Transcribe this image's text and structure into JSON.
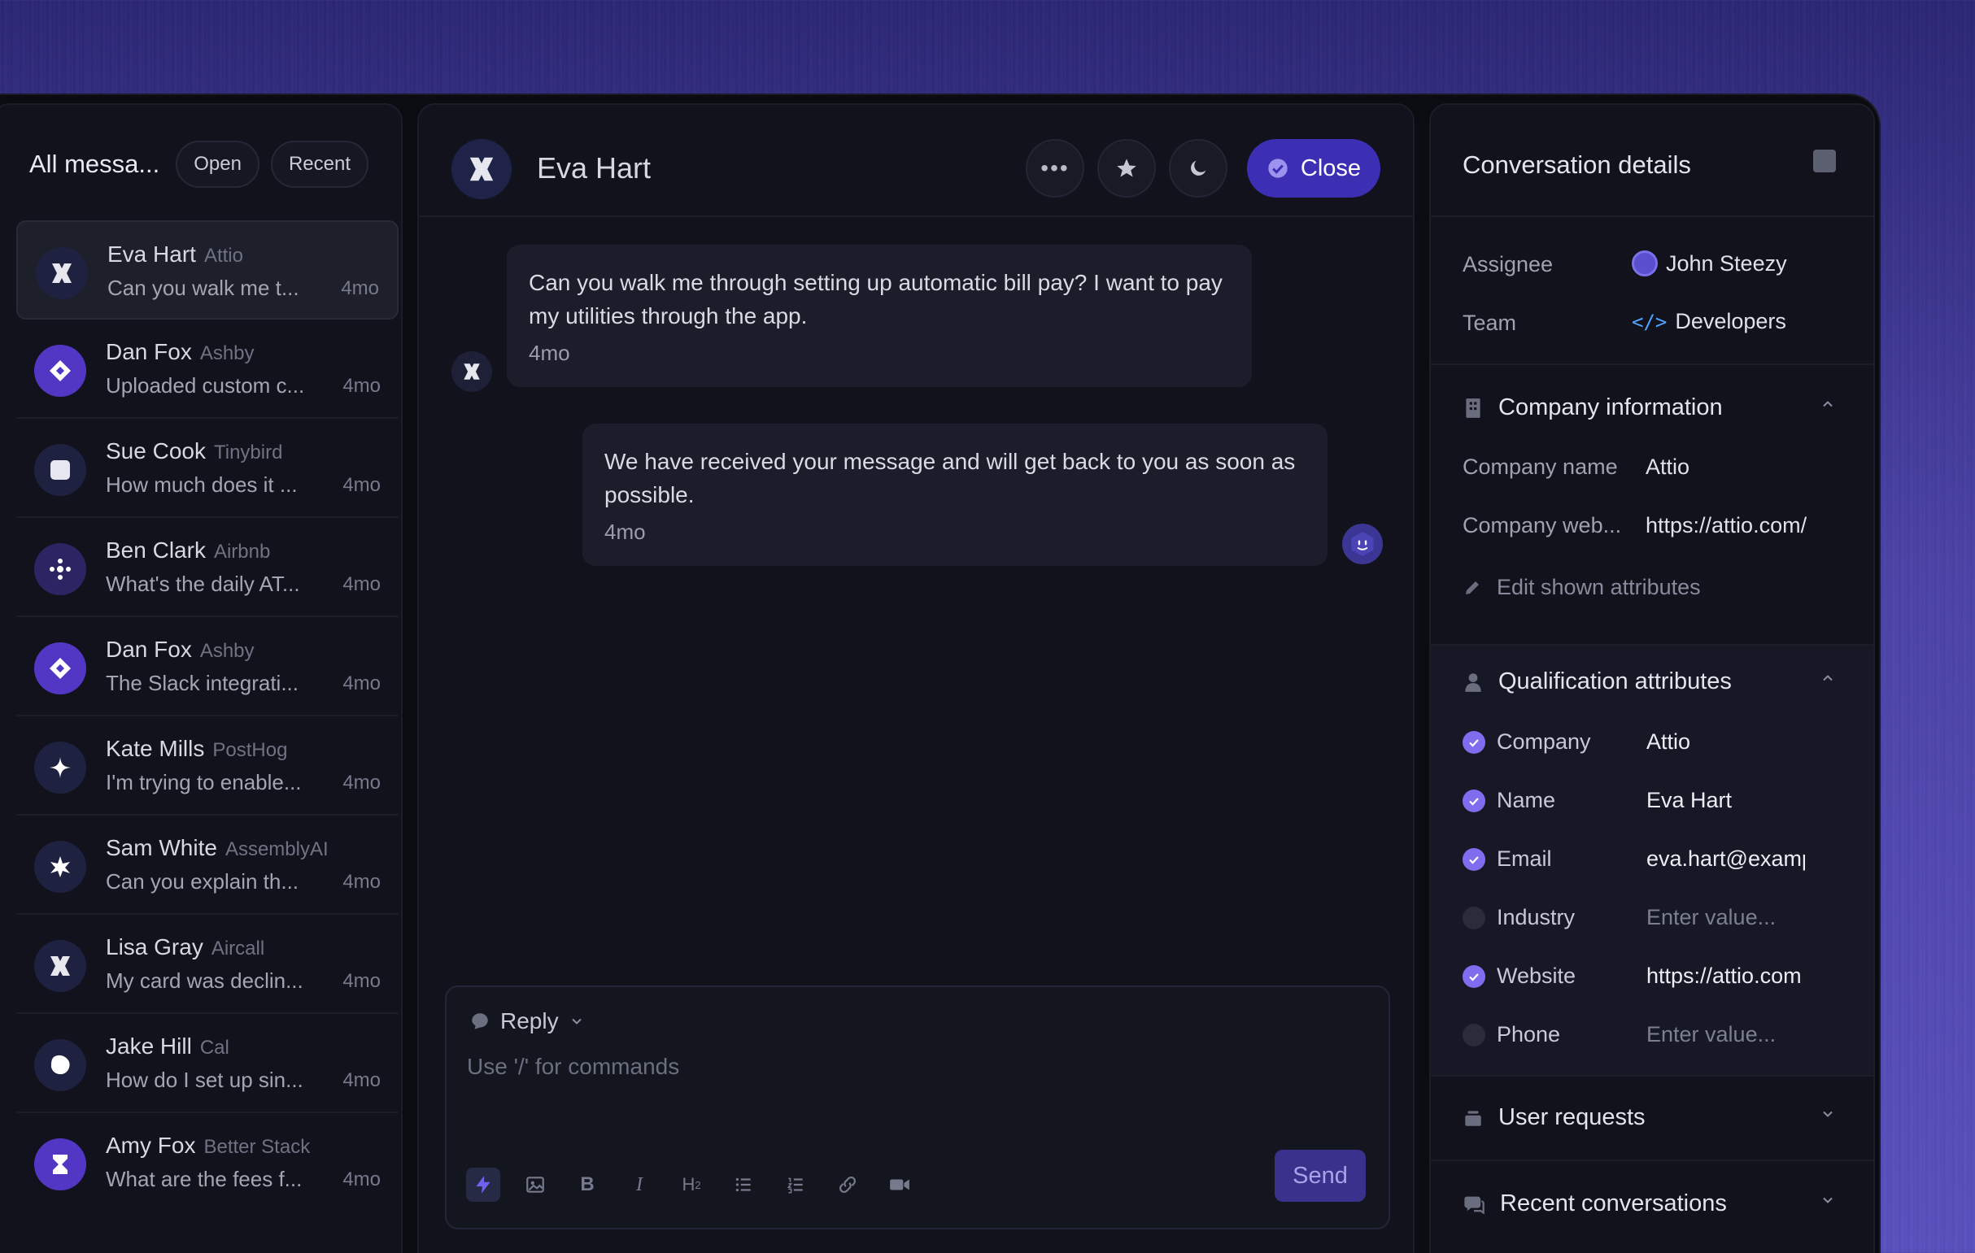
{
  "inbox": {
    "title": "All messa...",
    "filter_open": "Open",
    "filter_recent": "Recent"
  },
  "conversations": [
    {
      "name": "Eva Hart",
      "company": "Attio",
      "preview": "Can you walk me t...",
      "time": "4mo",
      "icon": "attio-icon"
    },
    {
      "name": "Dan Fox",
      "company": "Ashby",
      "preview": "Uploaded custom c...",
      "time": "4mo",
      "icon": "diamond-icon"
    },
    {
      "name": "Sue Cook",
      "company": "Tinybird",
      "preview": "How much does it ...",
      "time": "4mo",
      "icon": "square-icon"
    },
    {
      "name": "Ben Clark",
      "company": "Airbnb",
      "preview": "What's the daily AT...",
      "time": "4mo",
      "icon": "nodes-icon"
    },
    {
      "name": "Dan Fox",
      "company": "Ashby",
      "preview": "The Slack integrati...",
      "time": "4mo",
      "icon": "diamond-icon"
    },
    {
      "name": "Kate Mills",
      "company": "PostHog",
      "preview": "I'm trying to enable...",
      "time": "4mo",
      "icon": "sparkle-icon"
    },
    {
      "name": "Sam White",
      "company": "AssemblyAI",
      "preview": "Can you explain th...",
      "time": "4mo",
      "icon": "star-icon"
    },
    {
      "name": "Lisa Gray",
      "company": "Aircall",
      "preview": "My card was declin...",
      "time": "4mo",
      "icon": "attio-icon"
    },
    {
      "name": "Jake Hill",
      "company": "Cal",
      "preview": "How do I set up sin...",
      "time": "4mo",
      "icon": "blob-icon"
    },
    {
      "name": "Amy Fox",
      "company": "Better Stack",
      "preview": "What are the fees f...",
      "time": "4mo",
      "icon": "hourglass-icon"
    }
  ],
  "chat": {
    "contact_name": "Eva Hart",
    "close_label": "Close",
    "messages": [
      {
        "text": "Can you walk me through setting up automatic bill pay? I want to pay my utilities through the app.",
        "time": "4mo",
        "from": "customer"
      },
      {
        "text": "We have received your message and will get back to you as soon as possible.",
        "time": "4mo",
        "from": "bot"
      }
    ],
    "reply_mode": "Reply",
    "reply_placeholder": "Use '/' for commands",
    "send_label": "Send"
  },
  "details": {
    "title": "Conversation details",
    "assignee_label": "Assignee",
    "assignee_value": "John Steezy",
    "team_label": "Team",
    "team_value": "Developers",
    "company_section": "Company information",
    "company_name_label": "Company name",
    "company_name_value": "Attio",
    "company_web_label": "Company web...",
    "company_web_value": "https://attio.com/",
    "edit_attributes": "Edit shown attributes",
    "qualification_section": "Qualification attributes",
    "qualification": [
      {
        "label": "Company",
        "value": "Attio",
        "checked": true
      },
      {
        "label": "Name",
        "value": "Eva Hart",
        "checked": true
      },
      {
        "label": "Email",
        "value": "eva.hart@example.com",
        "checked": true
      },
      {
        "label": "Industry",
        "value": "Enter value...",
        "checked": false
      },
      {
        "label": "Website",
        "value": "https://attio.com",
        "checked": true
      },
      {
        "label": "Phone",
        "value": "Enter value...",
        "checked": false
      }
    ],
    "user_requests": "User requests",
    "recent_conversations": "Recent conversations"
  },
  "colors": {
    "accent": "#3c2fb4",
    "check": "#7f6df0",
    "background": "#0b0c12"
  }
}
